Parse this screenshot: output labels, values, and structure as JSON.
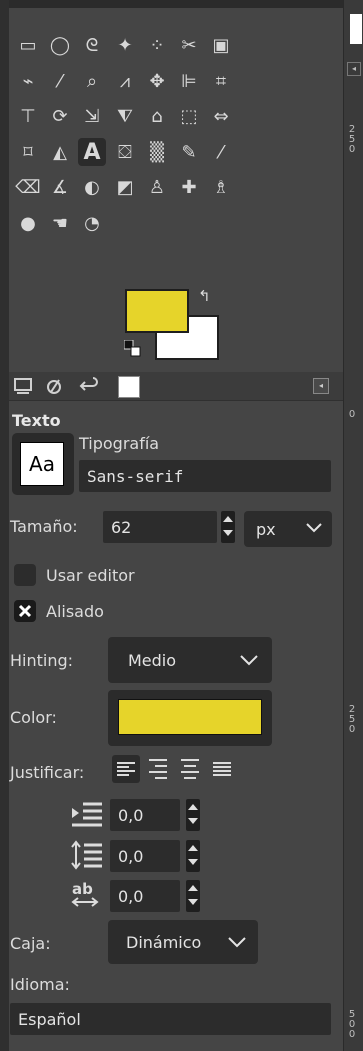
{
  "toolbox": {
    "tools": [
      {
        "name": "rect-select-icon",
        "glyph": "▭"
      },
      {
        "name": "ellipse-select-icon",
        "glyph": "◯"
      },
      {
        "name": "free-select-icon",
        "glyph": "ᘓ"
      },
      {
        "name": "fuzzy-select-icon",
        "glyph": "✦"
      },
      {
        "name": "select-by-color-icon",
        "glyph": "⁘"
      },
      {
        "name": "scissors-select-icon",
        "glyph": "✂"
      },
      {
        "name": "foreground-select-icon",
        "glyph": "▣"
      },
      {
        "name": "paths-icon",
        "glyph": "⌁"
      },
      {
        "name": "color-picker-icon",
        "glyph": "⁄"
      },
      {
        "name": "zoom-icon",
        "glyph": "⌕"
      },
      {
        "name": "measure-icon",
        "glyph": "⩘"
      },
      {
        "name": "move-icon",
        "glyph": "✥"
      },
      {
        "name": "align-icon",
        "glyph": "⊫"
      },
      {
        "name": "crop-icon",
        "glyph": "⌗"
      },
      {
        "name": "unified-transform-icon",
        "glyph": "⊤"
      },
      {
        "name": "rotate-icon",
        "glyph": "⟳"
      },
      {
        "name": "scale-icon",
        "glyph": "⇲"
      },
      {
        "name": "shear-icon",
        "glyph": "⧨"
      },
      {
        "name": "perspective-icon",
        "glyph": "⌂"
      },
      {
        "name": "3d-transform-icon",
        "glyph": "⬚"
      },
      {
        "name": "flip-icon",
        "glyph": "⇔"
      },
      {
        "name": "cage-transform-icon",
        "glyph": "⌑"
      },
      {
        "name": "warp-transform-icon",
        "glyph": "◭"
      },
      {
        "name": "text-icon",
        "glyph": "A"
      },
      {
        "name": "bucket-fill-icon",
        "glyph": "⛋"
      },
      {
        "name": "gradient-icon",
        "glyph": "▒"
      },
      {
        "name": "pencil-icon",
        "glyph": "✎"
      },
      {
        "name": "paintbrush-icon",
        "glyph": "⁄"
      },
      {
        "name": "eraser-icon",
        "glyph": "⌫"
      },
      {
        "name": "airbrush-icon",
        "glyph": "∡"
      },
      {
        "name": "ink-icon",
        "glyph": "◐"
      },
      {
        "name": "mypaint-brush-icon",
        "glyph": "◩"
      },
      {
        "name": "clone-icon",
        "glyph": "♙"
      },
      {
        "name": "heal-icon",
        "glyph": "✚"
      },
      {
        "name": "perspective-clone-icon",
        "glyph": "♗"
      },
      {
        "name": "blur-sharpen-icon",
        "glyph": "●"
      },
      {
        "name": "smudge-icon",
        "glyph": "☚"
      },
      {
        "name": "dodge-burn-icon",
        "glyph": "◔"
      }
    ],
    "active_tool_index": 23
  },
  "colors": {
    "foreground": "#e6d42a",
    "background": "#ffffff",
    "swap_glyph": "↰"
  },
  "tabs": {
    "icons": [
      "tool-options-icon",
      "device-status-icon",
      "undo-history-icon",
      "images-icon"
    ],
    "collapse_glyph": "◂"
  },
  "right_strip": {
    "ruler_marks": [
      "2\n5\n0",
      "0",
      "2\n5\n0",
      "5\n0\n0"
    ]
  },
  "tool_options": {
    "title": "Texto",
    "font_label": "Tipografía",
    "font_preview": "Aa",
    "font_value": "Sans-serif",
    "size_label": "Tamaño:",
    "size_value": "62",
    "unit_value": "px",
    "use_editor_label": "Usar editor",
    "use_editor_checked": false,
    "antialias_label": "Alisado",
    "antialias_checked": true,
    "hinting_label": "Hinting:",
    "hinting_value": "Medio",
    "color_label": "Color:",
    "color_value": "#e6d42a",
    "justify_label": "Justificar:",
    "justify_options": [
      "left",
      "right",
      "center",
      "fill"
    ],
    "justify_selected": 0,
    "indent_value": "0,0",
    "line_spacing_value": "0,0",
    "letter_spacing_value": "0,0",
    "box_label": "Caja:",
    "box_value": "Dinámico",
    "language_label": "Idioma:",
    "language_value": "Español"
  }
}
